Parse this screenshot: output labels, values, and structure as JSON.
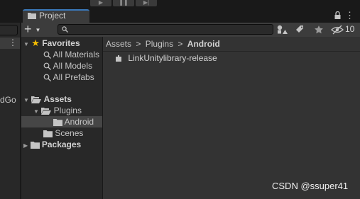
{
  "window": {
    "tab_title": "Project",
    "left_partial_text": "dGo"
  },
  "toolbar": {
    "create_label": "+",
    "search_placeholder": "",
    "hidden_count": "10",
    "icons": [
      "plus-icon",
      "chevron-down-icon",
      "search-icon",
      "filter-by-type-icon",
      "filter-by-label-icon",
      "favorite-star-icon",
      "hidden-eye-icon"
    ]
  },
  "tree": {
    "favorites_label": "Favorites",
    "favorites_items": [
      {
        "label": "All Materials"
      },
      {
        "label": "All Models"
      },
      {
        "label": "All Prefabs"
      }
    ],
    "assets_label": "Assets",
    "assets_children": [
      {
        "label": "Plugins"
      },
      {
        "label": "Android"
      },
      {
        "label": "Scenes"
      }
    ],
    "packages_label": "Packages"
  },
  "breadcrumb": {
    "items": [
      "Assets",
      "Plugins",
      "Android"
    ],
    "separator": ">"
  },
  "files": [
    {
      "name": "LinkUnitylibrary-release"
    }
  ],
  "watermark": "CSDN @ssuper41",
  "colors": {
    "accent": "#3a79bb",
    "star": "#f4bc02",
    "panel": "#282828",
    "main": "#333333"
  }
}
